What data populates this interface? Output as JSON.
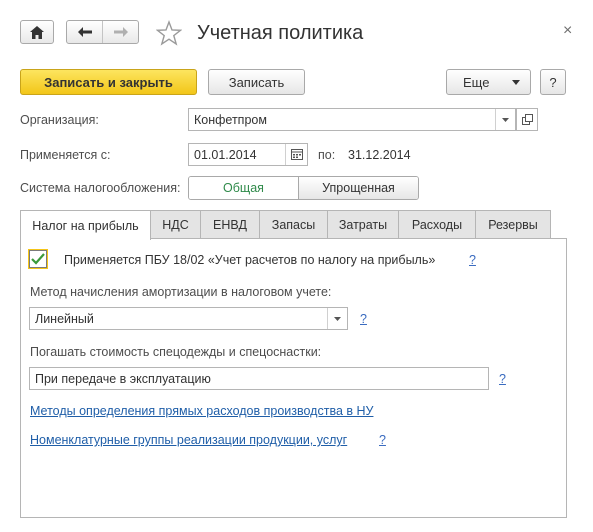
{
  "window": {
    "title": "Учетная политика",
    "close_glyph": "×"
  },
  "nav": {
    "home_icon": "home-icon",
    "back_icon": "arrow-left-icon",
    "forward_icon": "arrow-right-icon",
    "favorite_icon": "star-icon"
  },
  "toolbar": {
    "save_close_label": "Записать и закрыть",
    "save_label": "Записать",
    "more_label": "Еще",
    "help_label": "?"
  },
  "form": {
    "organization_label": "Организация:",
    "organization_value": "Конфетпром",
    "applies_from_label": "Применяется с:",
    "applies_from_value": "01.01.2014",
    "applies_to_label": "по:",
    "applies_to_value": "31.12.2014",
    "tax_system_label": "Система налогообложения:",
    "tax_system_options": [
      "Общая",
      "Упрощенная"
    ],
    "tax_system_selected": "Общая"
  },
  "tabs": [
    {
      "label": "Налог на прибыль",
      "active": true
    },
    {
      "label": "НДС",
      "active": false
    },
    {
      "label": "ЕНВД",
      "active": false
    },
    {
      "label": "Запасы",
      "active": false
    },
    {
      "label": "Затраты",
      "active": false
    },
    {
      "label": "Расходы",
      "active": false
    },
    {
      "label": "Резервы",
      "active": false
    }
  ],
  "panel": {
    "pbu_checkbox_checked": true,
    "pbu_label": "Применяется ПБУ 18/02 «Учет расчетов по налогу на прибыль»",
    "depreciation_label": "Метод начисления амортизации в налоговом учете:",
    "depreciation_value": "Линейный",
    "workwear_label": "Погашать стоимость спецодежды и спецоснастки:",
    "workwear_value": "При передаче в эксплуатацию",
    "direct_costs_link": "Методы определения прямых расходов производства в НУ",
    "nomenclature_link": "Номенклатурные группы реализации продукции, услуг",
    "help_mark": "?"
  },
  "colors": {
    "primary_button": "#f2c619",
    "link": "#1f5ea8",
    "selected_option": "#2f8a4a",
    "checkbox_focus": "#f5c518"
  }
}
